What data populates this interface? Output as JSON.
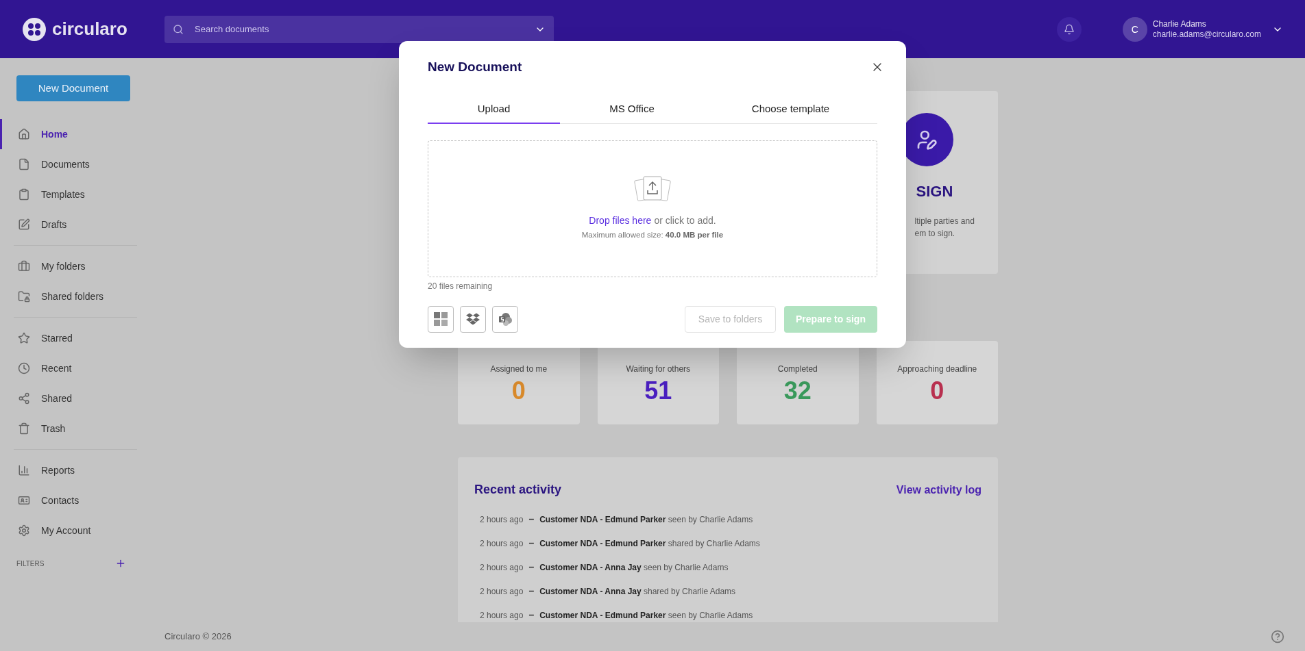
{
  "header": {
    "logo": "circularo",
    "search": {
      "placeholder": "Search documents"
    },
    "user": {
      "initial": "C",
      "name": "Charlie Adams",
      "email": "charlie.adams@circularo.com"
    }
  },
  "sidebar": {
    "new_document": "New Document",
    "groups": [
      [
        {
          "label": "Home",
          "selected": true
        },
        {
          "label": "Documents",
          "selected": false
        },
        {
          "label": "Templates",
          "selected": false
        },
        {
          "label": "Drafts",
          "selected": false
        }
      ],
      [
        {
          "label": "My folders",
          "selected": false
        },
        {
          "label": "Shared folders",
          "selected": false
        }
      ],
      [
        {
          "label": "Starred",
          "selected": false
        },
        {
          "label": "Recent",
          "selected": false
        },
        {
          "label": "Shared",
          "selected": false
        },
        {
          "label": "Trash",
          "selected": false
        }
      ],
      [
        {
          "label": "Reports",
          "selected": false
        },
        {
          "label": "Contacts",
          "selected": false
        },
        {
          "label": "My Account",
          "selected": false
        }
      ]
    ],
    "filters": "FILTERS"
  },
  "feature_card": {
    "title": "SIGN",
    "lines": [
      "ltiple parties and",
      "em to sign."
    ]
  },
  "stats": [
    {
      "label": "Assigned to me",
      "value": "0",
      "color": "#d98a2b"
    },
    {
      "label": "Waiting for others",
      "value": "51",
      "color": "#4a1fc0"
    },
    {
      "label": "Completed",
      "value": "32",
      "color": "#3a9a5c"
    },
    {
      "label": "Approaching deadline",
      "value": "0",
      "color": "#b8304f"
    }
  ],
  "recent_activity": {
    "title": "Recent activity",
    "link": "View activity log",
    "items": [
      {
        "time": "2 hours ago",
        "separator": "–",
        "text": "**Customer NDA - Edmund Parker** seen by Charlie Adams"
      },
      {
        "time": "2 hours ago",
        "separator": "–",
        "text": "**Customer NDA - Edmund Parker** shared by Charlie Adams"
      },
      {
        "time": "2 hours ago",
        "separator": "–",
        "text": "**Customer NDA - Anna Jay** seen by Charlie Adams"
      },
      {
        "time": "2 hours ago",
        "separator": "–",
        "text": "**Customer NDA - Anna Jay** shared by Charlie Adams"
      },
      {
        "time": "2 hours ago",
        "separator": "–",
        "text": "**Customer NDA - Edmund Parker** seen by Charlie Adams"
      }
    ]
  },
  "footer": "Circularo © 2026",
  "modal": {
    "title": "New Document",
    "tabs": [
      {
        "label": "Upload",
        "selected": true
      },
      {
        "label": "MS Office",
        "selected": false
      },
      {
        "label": "Choose template",
        "selected": false
      }
    ],
    "dropzone": {
      "link": "Drop files here",
      "text": "or click to add.",
      "limit": "Maximum allowed size: **40.0 MB per file**"
    },
    "remaining": "20 files remaining",
    "buttons": [
      {
        "label": "Save to folders",
        "kind": "outline",
        "disabled": true
      },
      {
        "label": "Prepare to sign",
        "kind": "primary",
        "disabled": true
      }
    ]
  }
}
